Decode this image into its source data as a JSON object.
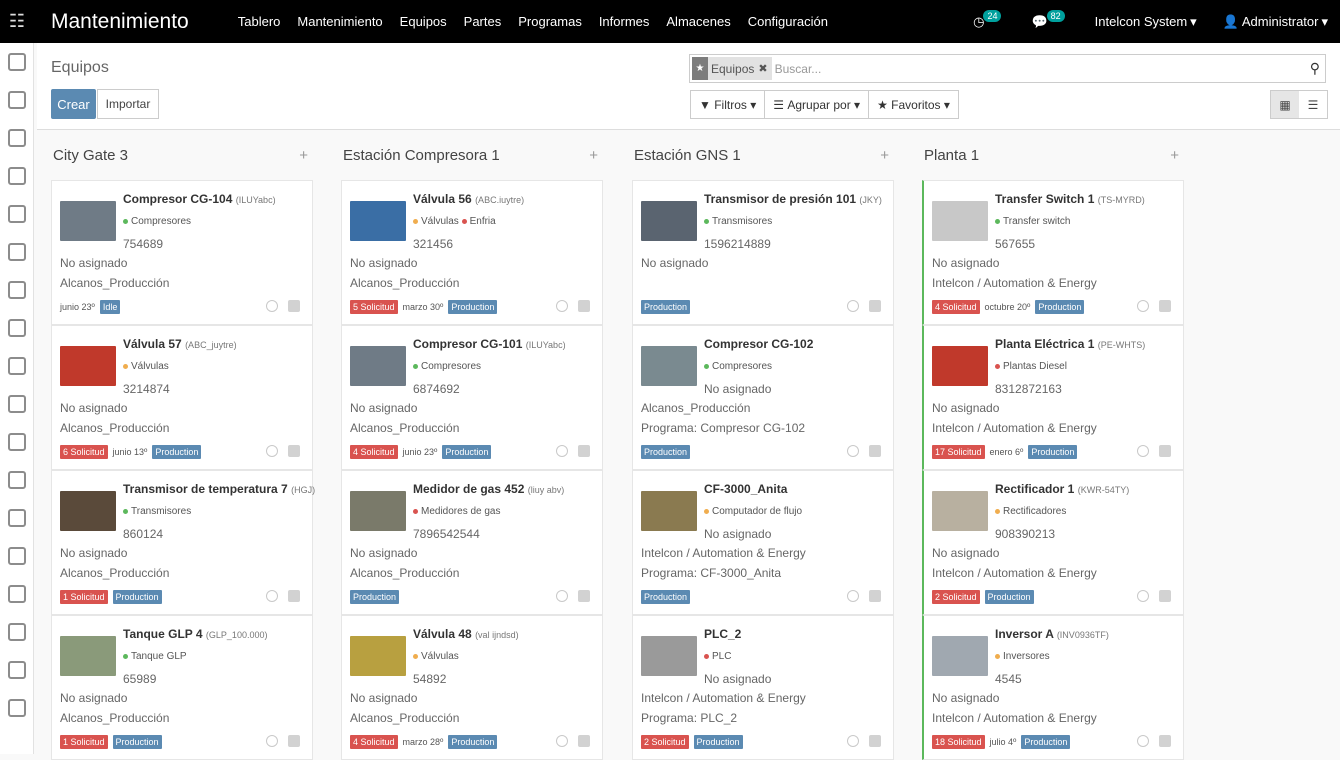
{
  "topbar": {
    "app_title": "Mantenimiento",
    "menu": [
      "Tablero",
      "Mantenimiento",
      "Equipos",
      "Partes",
      "Programas",
      "Informes",
      "Almacenes",
      "Configuración"
    ],
    "activity_count": "24",
    "message_count": "82",
    "company": "Intelcon System",
    "user": "Administrator"
  },
  "control": {
    "breadcrumb": "Equipos",
    "create_label": "Crear",
    "import_label": "Importar",
    "facet_label": "Equipos",
    "search_placeholder": "Buscar...",
    "filters_label": "Filtros",
    "groupby_label": "Agrupar por",
    "favorites_label": "Favoritos"
  },
  "columns": [
    {
      "title": "City Gate 3",
      "cards": [
        {
          "name": "Compresor CG-104",
          "code": "(ILUYabc)",
          "cats": [
            {
              "label": "Compresores",
              "color": "#5cb85c"
            }
          ],
          "serial": "754689",
          "line1": "No asignado",
          "line2": "Alcanos_Producción",
          "tags": [
            {
              "t": "junio 23º",
              "k": "dt"
            },
            {
              "t": "Idle",
              "k": "blu"
            }
          ],
          "img": "#6f7b86"
        },
        {
          "name": "Válvula 57",
          "code": "(ABC_juytre)",
          "cats": [
            {
              "label": "Válvulas",
              "color": "#f0ad4e"
            }
          ],
          "serial": "3214874",
          "line1": "No asignado",
          "line2": "Alcanos_Producción",
          "tags": [
            {
              "t": "6 Solicitud",
              "k": "red"
            },
            {
              "t": "junio 13º",
              "k": "dt"
            },
            {
              "t": "Production",
              "k": "blu"
            }
          ],
          "img": "#c0392b"
        },
        {
          "name": "Transmisor de temperatura 7",
          "code": "(HGJ)",
          "cats": [
            {
              "label": "Transmisores",
              "color": "#5cb85c"
            }
          ],
          "serial": "860124",
          "line1": "No asignado",
          "line2": "Alcanos_Producción",
          "tags": [
            {
              "t": "1 Solicitud",
              "k": "red"
            },
            {
              "t": "Production",
              "k": "blu"
            }
          ],
          "img": "#5a4a3a"
        },
        {
          "name": "Tanque GLP 4",
          "code": "(GLP_100.000)",
          "cats": [
            {
              "label": "Tanque GLP",
              "color": "#5cb85c"
            }
          ],
          "serial": "65989",
          "line1": "No asignado",
          "line2": "Alcanos_Producción",
          "tags": [
            {
              "t": "1 Solicitud",
              "k": "red"
            },
            {
              "t": "Production",
              "k": "blu"
            }
          ],
          "img": "#8a9a7a"
        }
      ]
    },
    {
      "title": "Estación Compresora 1",
      "cards": [
        {
          "name": "Válvula 56",
          "code": "(ABC.iuytre)",
          "cats": [
            {
              "label": "Válvulas",
              "color": "#f0ad4e"
            },
            {
              "label": "Enfria",
              "color": "#d9534f"
            }
          ],
          "serial": "321456",
          "line1": "No asignado",
          "line2": "Alcanos_Producción",
          "tags": [
            {
              "t": "5 Solicitud",
              "k": "red"
            },
            {
              "t": "marzo 30º",
              "k": "dt"
            },
            {
              "t": "Production",
              "k": "blu"
            }
          ],
          "img": "#3a6ea5"
        },
        {
          "name": "Compresor CG-101",
          "code": "(ILUYabc)",
          "cats": [
            {
              "label": "Compresores",
              "color": "#5cb85c"
            }
          ],
          "serial": "6874692",
          "line1": "No asignado",
          "line2": "Alcanos_Producción",
          "tags": [
            {
              "t": "4 Solicitud",
              "k": "red"
            },
            {
              "t": "junio 23º",
              "k": "dt"
            },
            {
              "t": "Production",
              "k": "blu"
            }
          ],
          "img": "#6f7b86"
        },
        {
          "name": "Medidor de gas 452",
          "code": "(liuy abv)",
          "cats": [
            {
              "label": "Medidores de gas",
              "color": "#d9534f"
            }
          ],
          "serial": "7896542544",
          "line1": "No asignado",
          "line2": "Alcanos_Producción",
          "tags": [
            {
              "t": "Production",
              "k": "blu"
            }
          ],
          "img": "#7a7a6a"
        },
        {
          "name": "Válvula 48",
          "code": "(val ijndsd)",
          "cats": [
            {
              "label": "Válvulas",
              "color": "#f0ad4e"
            }
          ],
          "serial": "54892",
          "line1": "No asignado",
          "line2": "Alcanos_Producción",
          "tags": [
            {
              "t": "4 Solicitud",
              "k": "red"
            },
            {
              "t": "marzo 28º",
              "k": "dt"
            },
            {
              "t": "Production",
              "k": "blu"
            }
          ],
          "img": "#b8a040"
        }
      ]
    },
    {
      "title": "Estación GNS 1",
      "cards": [
        {
          "name": "Transmisor de presión 101",
          "code": "(JKY)",
          "cats": [
            {
              "label": "Transmisores",
              "color": "#5cb85c"
            }
          ],
          "serial": "1596214889",
          "line1": "No asignado",
          "line2": "",
          "tags": [
            {
              "t": "Production",
              "k": "blu"
            }
          ],
          "img": "#5a6470"
        },
        {
          "name": "Compresor CG-102",
          "code": "",
          "cats": [
            {
              "label": "Compresores",
              "color": "#5cb85c"
            }
          ],
          "serial": "No asignado",
          "line1": "Alcanos_Producción",
          "line2": "Programa: Compresor CG-102",
          "tags": [
            {
              "t": "Production",
              "k": "blu"
            }
          ],
          "img": "#7a8a90"
        },
        {
          "name": "CF-3000_Anita",
          "code": "",
          "cats": [
            {
              "label": "Computador de flujo",
              "color": "#f0ad4e"
            }
          ],
          "serial": "No asignado",
          "line1": "Intelcon / Automation & Energy",
          "line2": "Programa: CF-3000_Anita",
          "tags": [
            {
              "t": "Production",
              "k": "blu"
            }
          ],
          "img": "#8a7a50"
        },
        {
          "name": "PLC_2",
          "code": "",
          "cats": [
            {
              "label": "PLC",
              "color": "#d9534f"
            }
          ],
          "serial": "No asignado",
          "line1": "Intelcon / Automation & Energy",
          "line2": "Programa: PLC_2",
          "tags": [
            {
              "t": "2 Solicitud",
              "k": "red"
            },
            {
              "t": "Production",
              "k": "blu"
            }
          ],
          "img": "#9a9a9a"
        }
      ]
    },
    {
      "title": "Planta 1",
      "cards": [
        {
          "name": "Transfer Switch 1",
          "code": "(TS-MYRD)",
          "cats": [
            {
              "label": "Transfer switch",
              "color": "#5cb85c"
            }
          ],
          "serial": "567655",
          "line1": "No asignado",
          "line2": "Intelcon / Automation & Energy",
          "tags": [
            {
              "t": "4 Solicitud",
              "k": "red"
            },
            {
              "t": "octubre 20º",
              "k": "dt"
            },
            {
              "t": "Production",
              "k": "blu"
            }
          ],
          "img": "#c8c8c8"
        },
        {
          "name": "Planta Eléctrica 1",
          "code": "(PE-WHTS)",
          "cats": [
            {
              "label": "Plantas Diesel",
              "color": "#d9534f"
            }
          ],
          "serial": "8312872163",
          "line1": "No asignado",
          "line2": "Intelcon / Automation & Energy",
          "tags": [
            {
              "t": "17 Solicitud",
              "k": "red"
            },
            {
              "t": "enero 6º",
              "k": "dt"
            },
            {
              "t": "Production",
              "k": "blu"
            }
          ],
          "img": "#c0392b"
        },
        {
          "name": "Rectificador 1",
          "code": "(KWR-54TY)",
          "cats": [
            {
              "label": "Rectificadores",
              "color": "#f0ad4e"
            }
          ],
          "serial": "908390213",
          "line1": "No asignado",
          "line2": "Intelcon / Automation & Energy",
          "tags": [
            {
              "t": "2 Solicitud",
              "k": "red"
            },
            {
              "t": "Production",
              "k": "blu"
            }
          ],
          "img": "#b8b0a0"
        },
        {
          "name": "Inversor A",
          "code": "(INV0936TF)",
          "cats": [
            {
              "label": "Inversores",
              "color": "#f0ad4e"
            }
          ],
          "serial": "4545",
          "line1": "No asignado",
          "line2": "Intelcon / Automation & Energy",
          "tags": [
            {
              "t": "18 Solicitud",
              "k": "red"
            },
            {
              "t": "julio 4º",
              "k": "dt"
            },
            {
              "t": "Production",
              "k": "blu"
            }
          ],
          "img": "#a0a8b0"
        }
      ]
    }
  ]
}
